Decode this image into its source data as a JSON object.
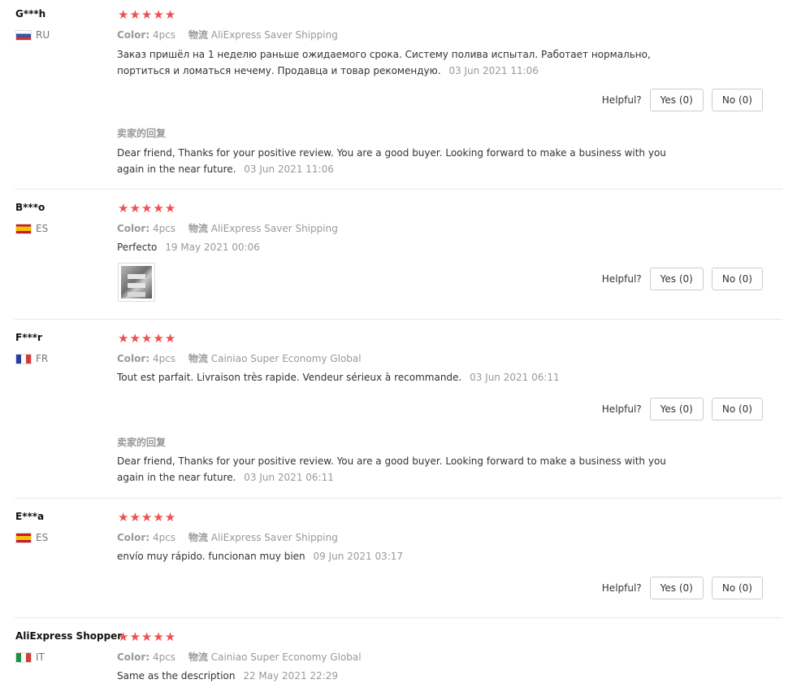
{
  "reviews": [
    {
      "buyer": "G***h",
      "country": "RU",
      "stars": "★★★★★",
      "color_label": "Color:",
      "color_value": "4pcs",
      "shipping_label": "物流",
      "shipping_value": "AliExpress Saver Shipping",
      "text": "Заказ пришёл на 1 неделю раньше ожидаемого срока. Систему полива испытал. Работает нормально, портиться и ломаться нечему. Продавца и товар рекомендую.",
      "time": "03 Jun 2021 11:06",
      "helpful_label": "Helpful?",
      "yes_label": "Yes (0)",
      "no_label": "No (0)",
      "seller_reply_title": "卖家的回复",
      "seller_reply": "Dear friend, Thanks for your positive review. You are a good buyer. Looking forward to make a business with you again in the near future.",
      "seller_reply_time": "03 Jun 2021 11:06"
    },
    {
      "buyer": "B***o",
      "country": "ES",
      "stars": "★★★★★",
      "color_label": "Color:",
      "color_value": "4pcs",
      "shipping_label": "物流",
      "shipping_value": "AliExpress Saver Shipping",
      "text": "Perfecto",
      "time": "19 May 2021 00:06",
      "helpful_label": "Helpful?",
      "yes_label": "Yes (0)",
      "no_label": "No (0)"
    },
    {
      "buyer": "F***r",
      "country": "FR",
      "stars": "★★★★★",
      "color_label": "Color:",
      "color_value": "4pcs",
      "shipping_label": "物流",
      "shipping_value": "Cainiao Super Economy Global",
      "text": "Tout est parfait. Livraison très rapide. Vendeur sérieux à recommande.",
      "time": "03 Jun 2021 06:11",
      "helpful_label": "Helpful?",
      "yes_label": "Yes (0)",
      "no_label": "No (0)",
      "seller_reply_title": "卖家的回复",
      "seller_reply": "Dear friend, Thanks for your positive review. You are a good buyer. Looking forward to make a business with you again in the near future.",
      "seller_reply_time": "03 Jun 2021 06:11"
    },
    {
      "buyer": "E***a",
      "country": "ES",
      "stars": "★★★★★",
      "color_label": "Color:",
      "color_value": "4pcs",
      "shipping_label": "物流",
      "shipping_value": "AliExpress Saver Shipping",
      "text": "envío muy rápido. funcionan muy bien",
      "time": "09 Jun 2021 03:17",
      "helpful_label": "Helpful?",
      "yes_label": "Yes (0)",
      "no_label": "No (0)"
    },
    {
      "buyer": "AliExpress Shopper",
      "country": "IT",
      "stars": "★★★★★",
      "color_label": "Color:",
      "color_value": "4pcs",
      "shipping_label": "物流",
      "shipping_value": "Cainiao Super Economy Global",
      "text": "Same as the description",
      "time": "22 May 2021 22:29"
    }
  ]
}
